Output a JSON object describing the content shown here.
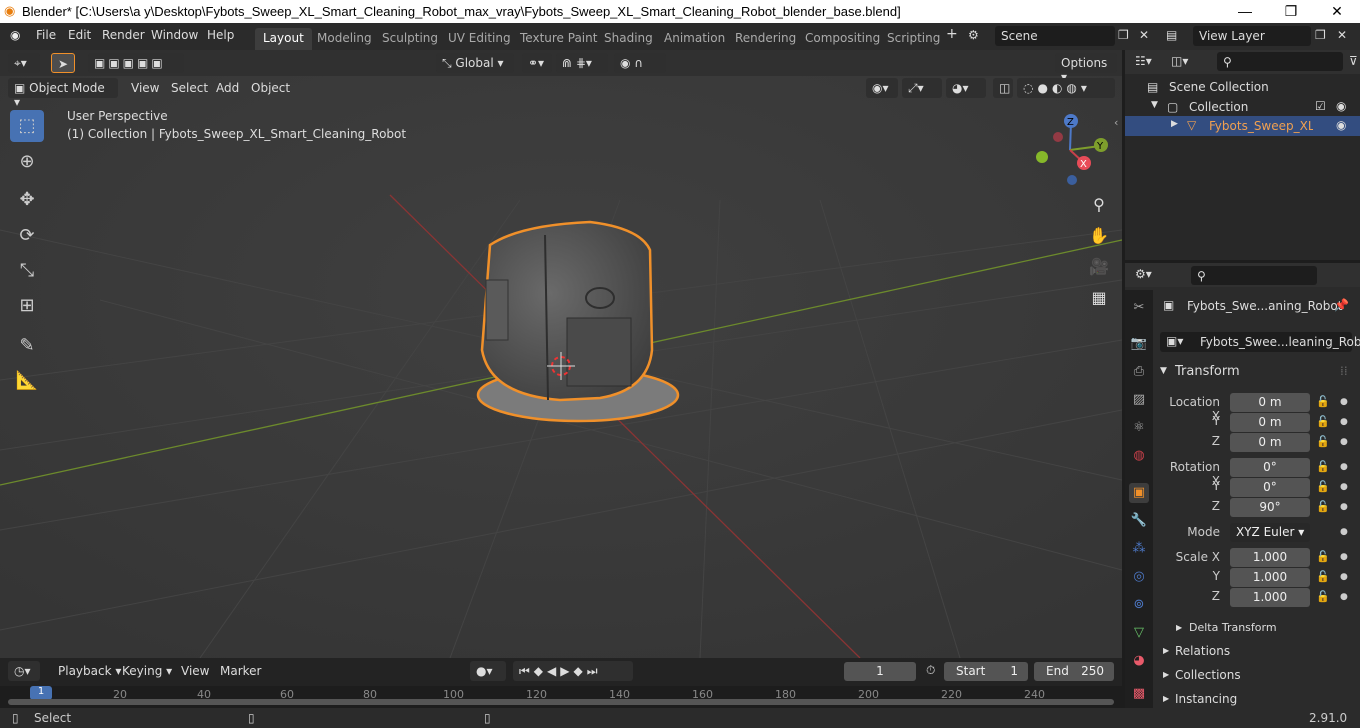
{
  "window": {
    "title": "Blender* [C:\\Users\\a y\\Desktop\\Fybots_Sweep_XL_Smart_Cleaning_Robot_max_vray\\Fybots_Sweep_XL_Smart_Cleaning_Robot_blender_base.blend]"
  },
  "menu": {
    "file": "File",
    "edit": "Edit",
    "render": "Render",
    "window": "Window",
    "help": "Help"
  },
  "workspaces": [
    "Layout",
    "Modeling",
    "Sculpting",
    "UV Editing",
    "Texture Paint",
    "Shading",
    "Animation",
    "Rendering",
    "Compositing",
    "Scripting"
  ],
  "scene": {
    "name": "Scene",
    "view_layer": "View Layer"
  },
  "viewport": {
    "mode": "Object Mode",
    "view": "View",
    "select": "Select",
    "add": "Add",
    "object": "Object",
    "orientation": "Global",
    "options": "Options",
    "perspective": "User Perspective",
    "collection_info": "(1) Collection | Fybots_Sweep_XL_Smart_Cleaning_Robot",
    "gizmo": {
      "x": "X",
      "y": "Y",
      "z": "Z"
    }
  },
  "outliner": {
    "scene_collection": "Scene Collection",
    "collection": "Collection",
    "object": "Fybots_Sweep_XL_Sı"
  },
  "properties": {
    "object_name": "Fybots_Swe...aning_Robot",
    "data_name": "Fybots_Swee...leaning_Robot",
    "transform": "Transform",
    "location_x_label": "Location X",
    "location_x": "0 m",
    "y_label": "Y",
    "location_y": "0 m",
    "z_label": "Z",
    "location_z": "0 m",
    "rotation_x_label": "Rotation X",
    "rotation_x": "0°",
    "rotation_y": "0°",
    "rotation_z": "90°",
    "mode_label": "Mode",
    "mode": "XYZ Euler",
    "scale_x_label": "Scale X",
    "scale_x": "1.000",
    "scale_y": "1.000",
    "scale_z": "1.000",
    "delta": "Delta Transform",
    "relations": "Relations",
    "collections": "Collections",
    "instancing": "Instancing"
  },
  "timeline": {
    "playback": "Playback",
    "keying": "Keying",
    "view": "View",
    "marker": "Marker",
    "current_frame": "1",
    "start_label": "Start",
    "start": "1",
    "end_label": "End",
    "end": "250",
    "ticks": [
      "1",
      "20",
      "40",
      "60",
      "80",
      "100",
      "120",
      "140",
      "160",
      "180",
      "200",
      "220",
      "240"
    ]
  },
  "status": {
    "select": "Select",
    "version": "2.91.0"
  }
}
